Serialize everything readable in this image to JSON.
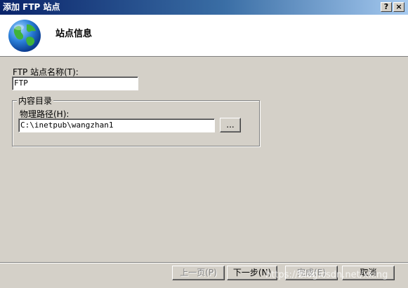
{
  "window": {
    "title": "添加 FTP 站点",
    "help_glyph": "?",
    "close_glyph": "×"
  },
  "header": {
    "title": "站点信息",
    "icon": "globe-icon"
  },
  "form": {
    "site_name_label": "FTP 站点名称(T):",
    "site_name_value": "FTP",
    "group_title": "内容目录",
    "physical_path_label": "物理路径(H):",
    "physical_path_value": "C:\\inetpub\\wangzhan1",
    "browse_label": "..."
  },
  "footer": {
    "prev_label": "上一页(P)",
    "next_label": "下一步(N)",
    "finish_label": "完成(E)",
    "cancel_label": "取消"
  },
  "watermark": "https://blog.csdn.net/xking"
}
